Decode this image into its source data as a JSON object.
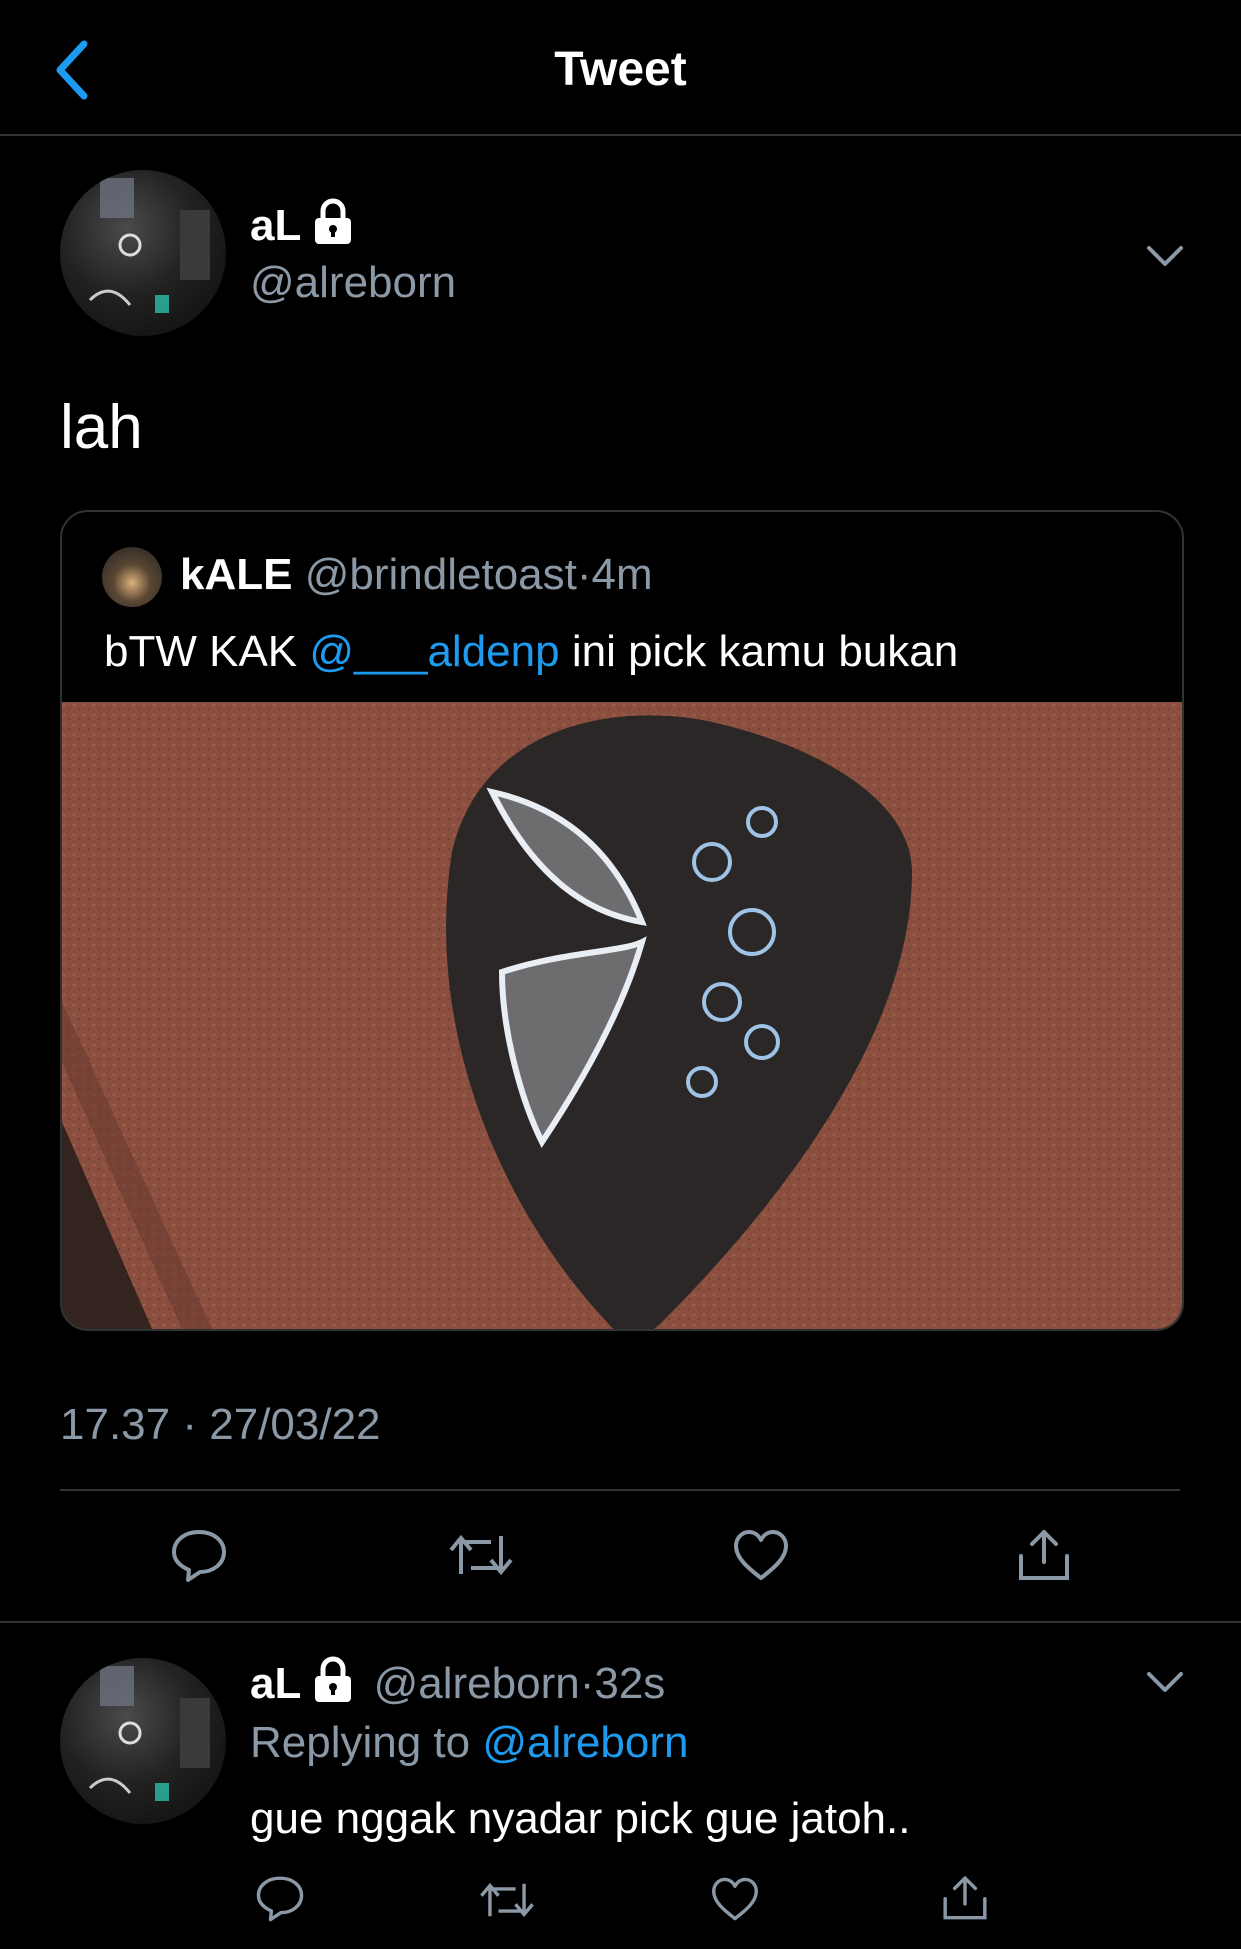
{
  "header": {
    "title": "Tweet"
  },
  "main_tweet": {
    "name": "aL",
    "handle": "@alreborn",
    "text": "lah",
    "quote": {
      "name": "kALE",
      "handle": "@brindletoast",
      "dot": "·",
      "time": "4m",
      "text_prefix": "bTW KAK ",
      "mention": "@___aldenp",
      "text_suffix": " ini pick kamu bukan"
    },
    "time": "17.37",
    "dot": "·",
    "date": "27/03/22"
  },
  "reply": {
    "name": "aL",
    "handle": "@alreborn",
    "dot": "·",
    "time": "32s",
    "replying_prefix": "Replying to ",
    "replying_to": "@alreborn",
    "text": "gue nggak nyadar pick gue jatoh.."
  },
  "colors": {
    "link": "#1d9bf0",
    "muted": "#8b98a5",
    "divider": "#2f3336",
    "background": "#000000"
  },
  "icons": [
    "back-arrow-icon",
    "lock-icon",
    "chevron-down-icon",
    "reply-icon",
    "retweet-icon",
    "like-icon",
    "share-icon"
  ]
}
